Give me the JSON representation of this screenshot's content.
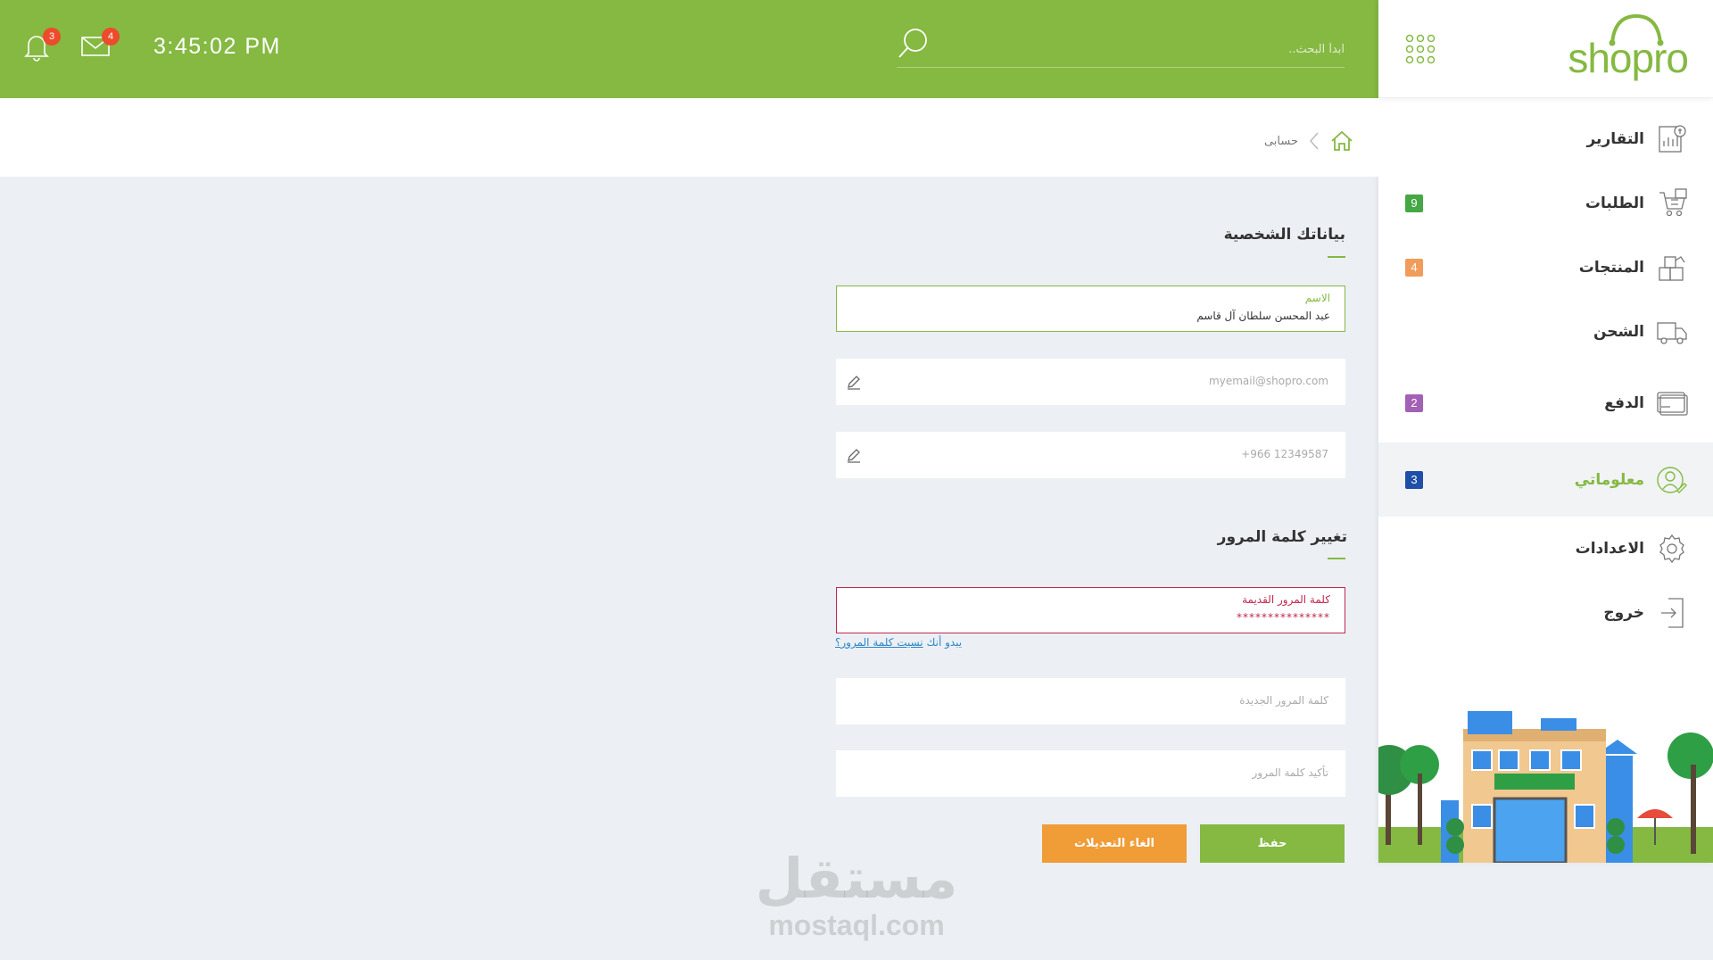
{
  "topbar": {
    "notifications_count": "3",
    "messages_count": "4",
    "clock": "3:45:02 PM",
    "search_placeholder": "ابدأ البحث.."
  },
  "brand": {
    "logo_text": "shopro"
  },
  "sidebar": {
    "items": [
      {
        "label": "التقارير",
        "icon": "reports-icon",
        "badge": ""
      },
      {
        "label": "الطلبات",
        "icon": "orders-icon",
        "badge": "9",
        "badge_color": "#45a845"
      },
      {
        "label": "المنتجات",
        "icon": "products-icon",
        "badge": "4",
        "badge_color": "#f09c5a"
      },
      {
        "label": "الشحن",
        "icon": "shipping-truck-icon",
        "badge": ""
      },
      {
        "label": "الدفع",
        "icon": "payment-card-icon",
        "badge": "2",
        "badge_color": "#a361b5"
      },
      {
        "label": "معلوماتي",
        "icon": "user-profile-icon",
        "badge": "3",
        "badge_color": "#1f4fa8",
        "active": true
      },
      {
        "label": "الاعدادات",
        "icon": "gear-icon",
        "badge": ""
      },
      {
        "label": "خروج",
        "icon": "logout-icon",
        "badge": ""
      }
    ]
  },
  "breadcrumb": {
    "current": "حسابى"
  },
  "personal": {
    "title": "بياناتك الشخصية",
    "name_label": "الاسم",
    "name_value": "عبد المحسن سلطان آل قاسم",
    "email": "myemail@shopro.com",
    "phone": "+966 12349587"
  },
  "password": {
    "title": "تغيير كلمة المرور",
    "old_label": "كلمة المرور القديمة",
    "old_value": "***************",
    "forgot_prefix": "يبدو أنك",
    "forgot_link": "نسيت كلمة المرور؟",
    "new_placeholder": "كلمة المرور الجديدة",
    "confirm_placeholder": "تأكيد كلمة المرور"
  },
  "actions": {
    "save": "حفظ",
    "cancel": "الغاء التعديلات"
  },
  "watermark": {
    "arabic": "مستقل",
    "english": "mostaql.com"
  },
  "colors": {
    "brand_green": "#85b942",
    "orange": "#f09c37",
    "error": "#c0284f",
    "link": "#2c87c8"
  }
}
